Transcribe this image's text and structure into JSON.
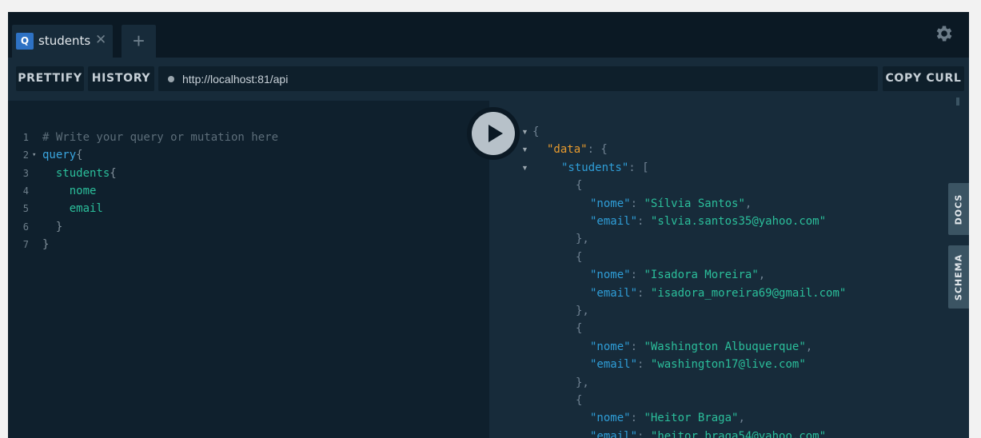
{
  "tab": {
    "badge": "Q",
    "title": "students",
    "close": "✕",
    "add": "+"
  },
  "toolbar": {
    "prettify": "PRETTIFY",
    "history": "HISTORY",
    "url": "http://localhost:81/api",
    "copy_curl": "COPY CURL"
  },
  "editor": {
    "lines": [
      {
        "num": "1",
        "fold": "",
        "text": "# Write your query or mutation here",
        "type": "comment"
      },
      {
        "num": "2",
        "fold": "▾",
        "text": "query{",
        "type": "keyword"
      },
      {
        "num": "3",
        "fold": "",
        "text": "  students{",
        "type": "field"
      },
      {
        "num": "4",
        "fold": "",
        "text": "    nome",
        "type": "field"
      },
      {
        "num": "5",
        "fold": "",
        "text": "    email",
        "type": "field"
      },
      {
        "num": "6",
        "fold": "",
        "text": "  }",
        "type": "punct"
      },
      {
        "num": "7",
        "fold": "",
        "text": "}",
        "type": "punct"
      }
    ]
  },
  "result": {
    "open_brace": "{",
    "data_key": "\"data\"",
    "students_key": "\"students\"",
    "students": [
      {
        "nome": "Sílvia Santos",
        "email": "slvia.santos35@yahoo.com"
      },
      {
        "nome": "Isadora Moreira",
        "email": "isadora_moreira69@gmail.com"
      },
      {
        "nome": "Washington Albuquerque",
        "email": "washington17@live.com"
      },
      {
        "nome": "Heitor Braga",
        "email": "heitor_braga54@yahoo.com"
      }
    ]
  },
  "side": {
    "docs": "DOCS",
    "schema": "SCHEMA"
  },
  "icons": {
    "settings": "gear-icon",
    "run": "play-icon"
  },
  "colors": {
    "accent": "#2e72c4",
    "string": "#2bbf9b",
    "key": "#2f9ed8",
    "data_key": "#e89b2e"
  }
}
